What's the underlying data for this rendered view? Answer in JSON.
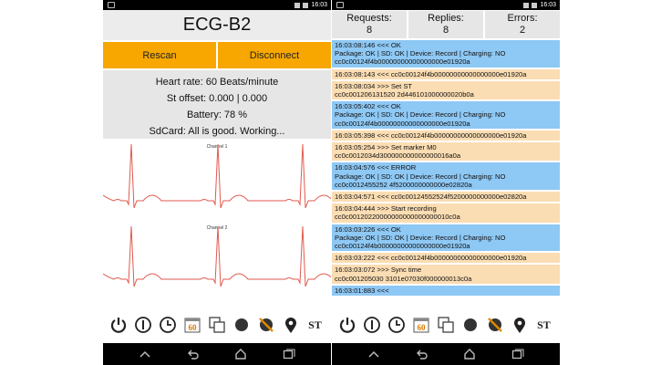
{
  "status_time": "16:03",
  "left": {
    "title": "ECG-B2",
    "rescan_label": "Rescan",
    "disconnect_label": "Disconnect",
    "heart_rate": "Heart rate: 60 Beats/minute",
    "st_offset": "St offset: 0.000 | 0.000",
    "battery": "Battery: 78 %",
    "sdcard": "SdCard: All is good. Working...",
    "channel1_label": "Channel 1",
    "channel2_label": "Channel 2",
    "trace_color": "#e05a4e"
  },
  "right": {
    "requests_label": "Requests:",
    "requests_value": "8",
    "replies_label": "Replies:",
    "replies_value": "8",
    "errors_label": "Errors:",
    "errors_value": "2",
    "log": [
      {
        "kind": "in",
        "lines": [
          "16:03:08:146 <<< OK",
          "Package: OK | SD: OK | Device: Record | Charging: NO",
          "cc0c00124f4b00000000000000000e01920a"
        ]
      },
      {
        "kind": "out",
        "lines": [
          "16:03:08:143 <<< cc0c00124f4b00000000000000000e01920a"
        ]
      },
      {
        "kind": "out",
        "lines": [
          "16:03:08:034 >>> Set ST",
          "cc0c001206131520 2d446101000000020b0a"
        ]
      },
      {
        "kind": "in",
        "lines": [
          "16:03:05:402 <<< OK",
          "Package: OK | SD: OK | Device: Record | Charging: NO",
          "cc0c00124f4b00000000000000000e01920a"
        ]
      },
      {
        "kind": "out",
        "lines": [
          "16:03:05:398 <<< cc0c00124f4b00000000000000000e01920a"
        ]
      },
      {
        "kind": "out",
        "lines": [
          "16:03:05:254 >>> Set marker M0",
          "cc0c0012034d300000000000000016a0a"
        ]
      },
      {
        "kind": "in",
        "lines": [
          "16:03:04:576 <<< ERROR",
          "Package: OK | SD: OK | Device: Record | Charging: NO",
          "cc0c0012455252 4f5200000000000e02820a"
        ]
      },
      {
        "kind": "out",
        "lines": [
          "16:03:04:571 <<< cc0c00124552524f5200000000000e02820a"
        ]
      },
      {
        "kind": "out",
        "lines": [
          "16:03:04:444 >>> Start recording",
          "cc0c00120220000000000000000010c0a"
        ]
      },
      {
        "kind": "in",
        "lines": [
          "16:03:03:226 <<< OK",
          "Package: OK | SD: OK | Device: Record | Charging: NO",
          "cc0c00124f4b00000000000000000e01920a"
        ]
      },
      {
        "kind": "out",
        "lines": [
          "16:03:03:222 <<< cc0c00124f4b00000000000000000e01920a"
        ]
      },
      {
        "kind": "out",
        "lines": [
          "16:03:03:072 >>> Sync time",
          "cc0c001205030 3101e07030f000000013c0a"
        ]
      },
      {
        "kind": "in",
        "lines": [
          "16:03:01:883 <<<"
        ]
      }
    ]
  },
  "toolbar": {
    "icons": [
      "power-icon",
      "info-icon",
      "clock-icon",
      "calendar-60-icon",
      "copy-icon",
      "record-dot-icon",
      "satellite-off-icon",
      "location-pin-icon",
      "st-icon"
    ],
    "calendar_text": "60",
    "st_text": "ST"
  },
  "colors": {
    "button_orange": "#f7a700",
    "incoming_blue": "#8ec8f4",
    "outgoing_peach": "#fbddb3",
    "panel_gray": "#e6e6e6"
  }
}
